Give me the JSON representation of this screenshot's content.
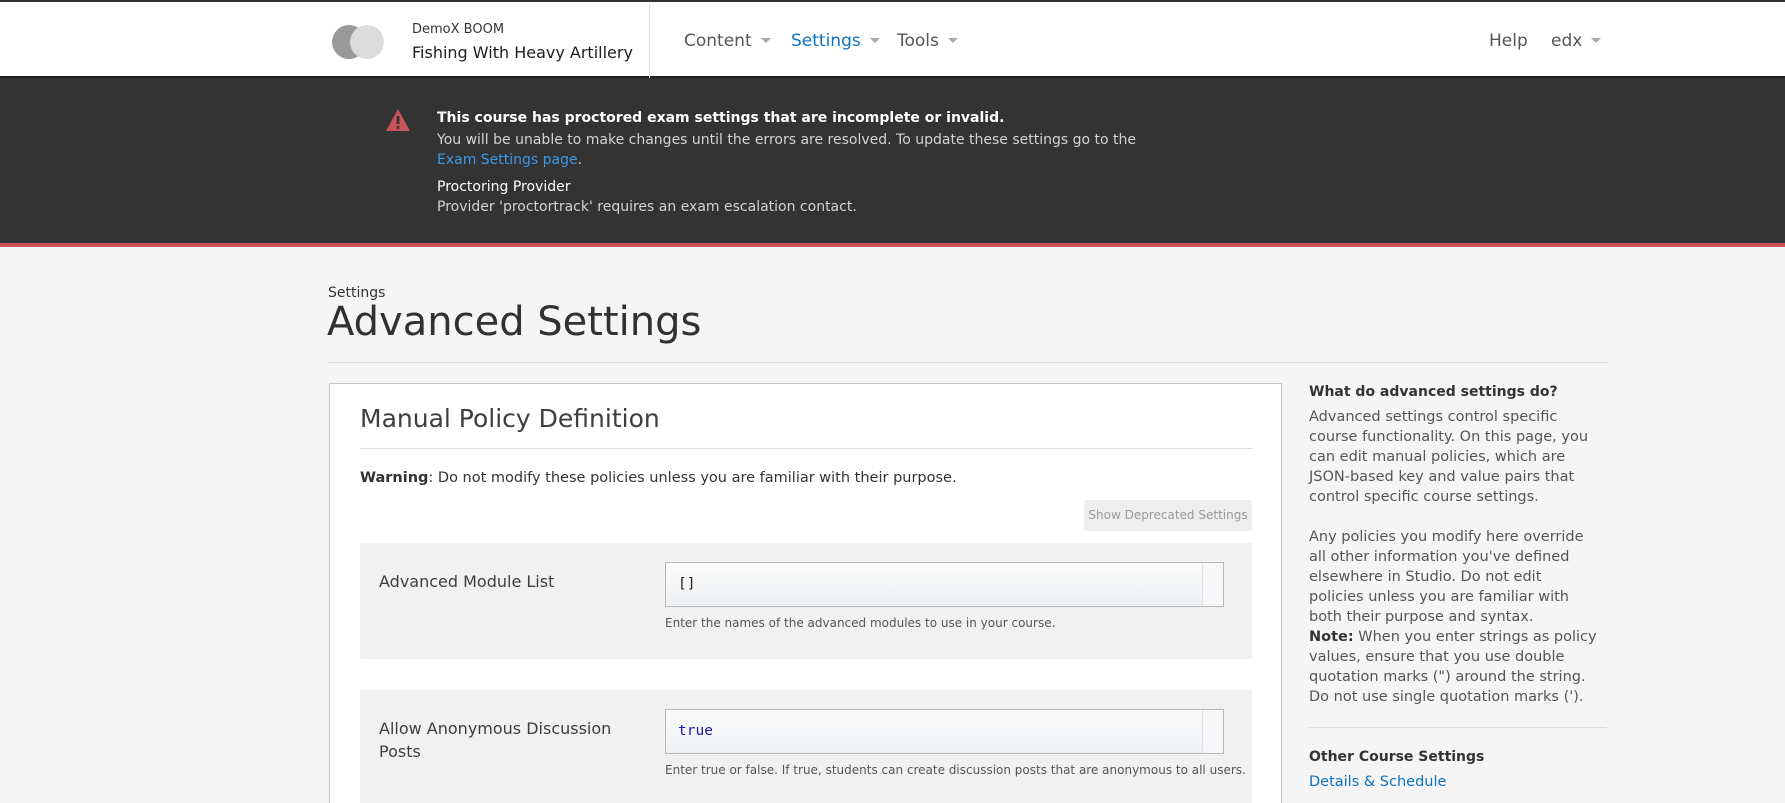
{
  "header": {
    "course_org": "DemoX BOOM",
    "course_title": "Fishing With Heavy Artillery",
    "nav": [
      {
        "label": "Content",
        "active": false
      },
      {
        "label": "Settings",
        "active": true
      },
      {
        "label": "Tools",
        "active": false
      }
    ],
    "help_label": "Help",
    "user_label": "edx"
  },
  "alert": {
    "title": "This course has proctored exam settings that are incomplete or invalid.",
    "message": "You will be unable to make changes until the errors are resolved. To update these settings go to the ",
    "link_text": "Exam Settings page",
    "message_end": ".",
    "sub_title": "Proctoring Provider",
    "sub_message": "Provider 'proctortrack' requires an exam escalation contact.",
    "icon": "warning-triangle-icon",
    "accent_color": "#c9535a"
  },
  "page": {
    "breadcrumb": "Settings",
    "title": "Advanced Settings"
  },
  "main": {
    "section_title": "Manual Policy Definition",
    "warning_label": "Warning",
    "warning_text": ": Do not modify these policies unless you are familiar with their purpose.",
    "deprecated_button": "Show Deprecated Settings",
    "fields": [
      {
        "label": "Advanced Module List",
        "value": "[]",
        "help": "Enter the names of the advanced modules to use in your course."
      },
      {
        "label": "Allow Anonymous Discussion Posts",
        "value": "true",
        "help": "Enter true or false. If true, students can create discussion posts that are anonymous to all users."
      }
    ]
  },
  "sidebar": {
    "heading": "What do advanced settings do?",
    "para1": "Advanced settings control specific course functionality. On this page, you can edit manual policies, which are JSON-based key and value pairs that control specific course settings.",
    "para2": "Any policies you modify here override all other information you've defined elsewhere in Studio. Do not edit policies unless you are familiar with both their purpose and syntax.",
    "note_label": "Note:",
    "note_text": " When you enter strings as policy values, ensure that you use double quotation marks (\") around the string. Do not use single quotation marks (').",
    "other_heading": "Other Course Settings",
    "link_details": "Details & Schedule"
  },
  "colors": {
    "link": "#0d72c1",
    "alert_bg": "#333333",
    "alert_link": "#3c9ae6"
  }
}
